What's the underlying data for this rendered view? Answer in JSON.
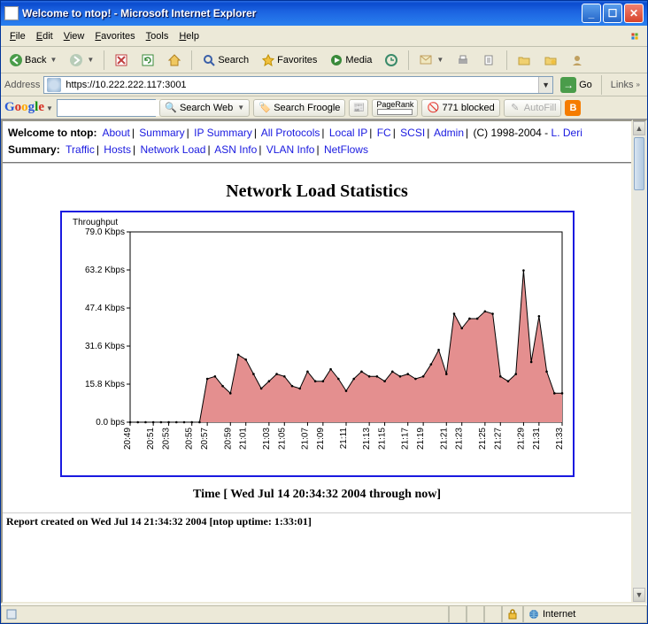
{
  "window": {
    "title": "Welcome to ntop! - Microsoft Internet Explorer"
  },
  "menu": {
    "items": [
      "File",
      "Edit",
      "View",
      "Favorites",
      "Tools",
      "Help"
    ]
  },
  "toolbar": {
    "back": "Back",
    "search": "Search",
    "favorites": "Favorites",
    "media": "Media"
  },
  "address": {
    "label": "Address",
    "url": "https://10.222.222.117:3001",
    "go": "Go",
    "links": "Links"
  },
  "googlebar": {
    "search_web": "Search Web",
    "search_froogle": "Search Froogle",
    "pagerank": "PageRank",
    "blocked": "771 blocked",
    "autofill": "AutoFill"
  },
  "ntop": {
    "welcome": "Welcome to ntop:",
    "top_links": [
      "About",
      "Summary",
      "IP Summary",
      "All Protocols",
      "Local IP",
      "FC",
      "SCSI",
      "Admin"
    ],
    "copyright": "(C) 1998-2004 -",
    "author": "L. Deri",
    "summary_label": "Summary:",
    "summary_links": [
      "Traffic",
      "Hosts",
      "Network Load",
      "ASN Info",
      "VLAN Info",
      "NetFlows"
    ]
  },
  "page": {
    "title": "Network Load Statistics",
    "time_caption": "Time [ Wed Jul 14 20:34:32 2004 through now]",
    "report_footer": "Report created on Wed Jul 14 21:34:32 2004 [ntop uptime: 1:33:01]"
  },
  "statusbar": {
    "zone": "Internet"
  },
  "chart_data": {
    "type": "area",
    "title": "Throughput",
    "ylabel": "",
    "xlabel": "",
    "ylim": [
      0,
      79.0
    ],
    "y_ticks": [
      0.0,
      15.8,
      31.6,
      47.4,
      63.2,
      79.0
    ],
    "y_tick_labels": [
      "0.0 bps",
      "15.8 Kbps",
      "31.6 Kbps",
      "47.4 Kbps",
      "63.2 Kbps",
      "79.0 Kbps"
    ],
    "categories": [
      "20:49",
      "20:51",
      "20:53",
      "20:55",
      "20:57",
      "20:59",
      "21:01",
      "21:03",
      "21:05",
      "21:07",
      "21:09",
      "21:11",
      "21:13",
      "21:15",
      "21:17",
      "21:19",
      "21:21",
      "21:23",
      "21:25",
      "21:27",
      "21:29",
      "21:31",
      "21:33"
    ],
    "series": [
      {
        "name": "Throughput",
        "values": [
          0,
          0,
          0,
          0,
          0,
          0,
          0,
          0,
          0,
          0,
          18,
          19,
          15,
          12,
          28,
          26,
          20,
          14,
          17,
          20,
          19,
          15,
          14,
          21,
          17,
          17,
          22,
          18,
          13,
          18,
          21,
          19,
          19,
          17,
          21,
          19,
          20,
          18,
          19,
          24,
          30,
          20,
          45,
          39,
          43,
          43,
          46,
          45,
          19,
          17,
          20,
          63,
          25,
          44,
          21,
          12,
          12
        ]
      }
    ],
    "fill_color": "#e48f8f",
    "line_color": "#000"
  }
}
